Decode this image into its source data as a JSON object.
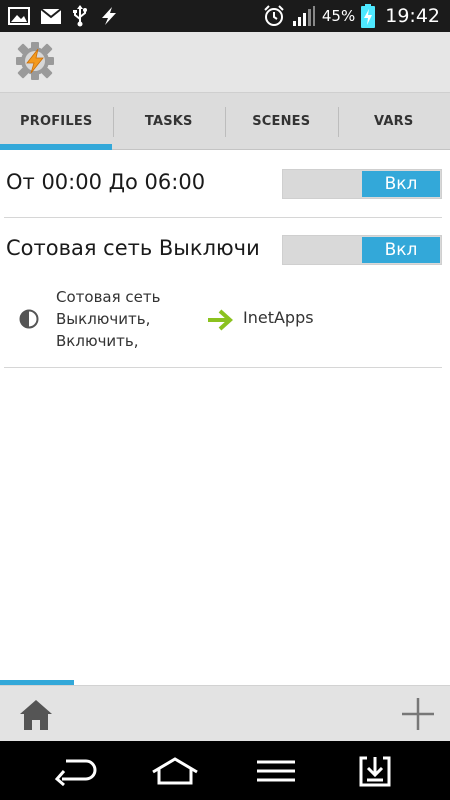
{
  "status_bar": {
    "battery_percent": "45%",
    "time": "19:42",
    "left_icons": [
      "image-icon",
      "mail-icon",
      "usb-icon",
      "tasker-bolt-icon"
    ],
    "right_icons": [
      "alarm-icon",
      "signal-icon",
      "battery-charging-icon"
    ]
  },
  "app_bar": {
    "icon": "tasker-gear-icon"
  },
  "tabs": [
    {
      "label": "PROFILES",
      "active": true
    },
    {
      "label": "TASKS",
      "active": false
    },
    {
      "label": "SCENES",
      "active": false
    },
    {
      "label": "VARS",
      "active": false
    }
  ],
  "profiles": [
    {
      "name": "От 00:00 До 06:00",
      "toggle_label": "Вкл"
    },
    {
      "name": "Сотовая сеть Выключи",
      "toggle_label": "Вкл",
      "context": {
        "icon": "half-circle-icon",
        "lines": [
          "Сотовая сеть",
          "Выключить,",
          "Включить,"
        ]
      },
      "task": {
        "icon": "arrow-right-icon",
        "name": "InetApps"
      }
    }
  ],
  "bottom_bar": {
    "home_icon": "home-icon",
    "add_icon": "plus-icon"
  },
  "nav_bar": {
    "icons": [
      "back-icon",
      "home-outline-icon",
      "menu-icon",
      "download-icon"
    ]
  },
  "colors": {
    "accent": "#33a8d9",
    "arrow": "#8bc21f",
    "status_bar_bg": "#1b1b1b",
    "battery": "#4ee8ff"
  }
}
